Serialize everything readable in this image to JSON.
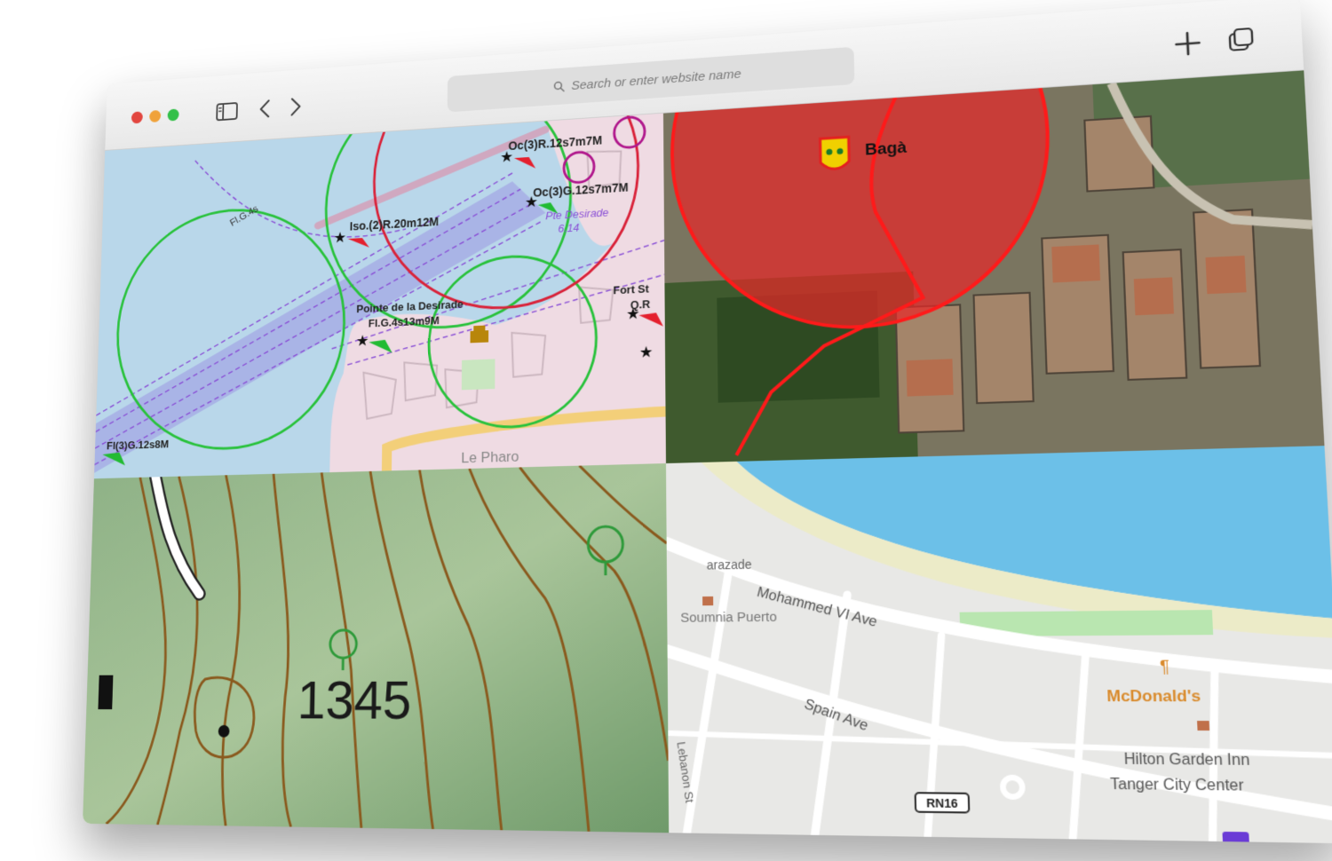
{
  "browser": {
    "address_placeholder": "Search or enter website name",
    "traffic_lights": [
      "#e2463f",
      "#f0a23a",
      "#33c048"
    ]
  },
  "nautical_map": {
    "labels": {
      "light1": "Oc(3)R.12s7m7M",
      "light2": "Oc(3)G.12s7m7M",
      "light3": "Iso.(2)R.20m12M",
      "point_name": "Pointe de la Desirade",
      "point_light": "Fl.G.4s13m9M",
      "fort": "Fort St",
      "fort_light": "Q.R",
      "light_bottom": "Fl(3)G.12s8M",
      "lighthouse": "Le Pharo",
      "zone": "Fl.G.4s",
      "area_label": "Pte Desirade",
      "area_value": "6.14"
    }
  },
  "satellite_map": {
    "place_name": "Bagà"
  },
  "topo_map": {
    "elevation": "1345"
  },
  "street_map": {
    "streets": {
      "main_avenue": "Mohammed VI Ave",
      "second_avenue": "Spain Ave",
      "side_street": "Lebanon St",
      "road_shield": "RN16",
      "top_left_label": "arazade"
    },
    "pois": {
      "hotel1": "Soumnia Puerto",
      "restaurant": "McDonald's",
      "hotel2_line1": "Hilton Garden Inn",
      "hotel2_line2": "Tanger City Center"
    },
    "colors": {
      "sea": "#6cc0e8",
      "restaurant": "#d98a2b"
    }
  }
}
